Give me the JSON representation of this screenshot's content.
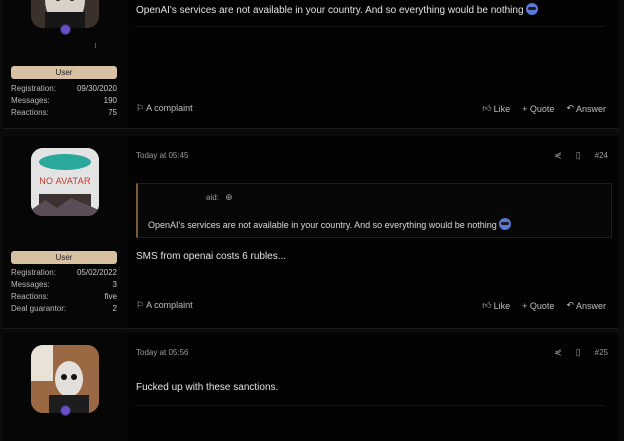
{
  "posts": [
    {
      "author_role": "User",
      "stats": [
        {
          "label": "Registration:",
          "value": "09/30/2020"
        },
        {
          "label": "Messages:",
          "value": "190"
        },
        {
          "label": "Reactions:",
          "value": "75"
        }
      ],
      "message": "OpenAI's services are not available in your country. And so everything would be nothing",
      "complaint": "A complaint",
      "like": "Like",
      "quote": "+ Quote",
      "answer": "Answer"
    },
    {
      "time": "Today at 05:45",
      "number": "#24",
      "avatar_text": "NO AVATAR",
      "author_role": "User",
      "stats": [
        {
          "label": "Registration:",
          "value": "05/02/2022"
        },
        {
          "label": "Messages:",
          "value": "3"
        },
        {
          "label": "Reactions:",
          "value": "five"
        },
        {
          "label": "Deal guarantor:",
          "value": "2"
        }
      ],
      "quote_header": "aid:",
      "quote_text": "OpenAI's services are not available in your country. And so everything would be nothing",
      "message": "SMS from openai costs 6 rubles...",
      "complaint": "A complaint",
      "like": "Like",
      "quote": "+ Quote",
      "answer": "Answer"
    },
    {
      "time": "Today at 05:56",
      "number": "#25",
      "message": "Fucked up with these sanctions."
    }
  ],
  "icons": {
    "like": "thumbs-up-icon",
    "reply": "reply-arrow-icon",
    "share": "share-icon",
    "bookmark": "bookmark-icon",
    "flag": "flag-icon"
  },
  "colors": {
    "badge": "#d8c0a3",
    "quote_border": "#7a5a3a",
    "online": "#6b4fc6"
  }
}
